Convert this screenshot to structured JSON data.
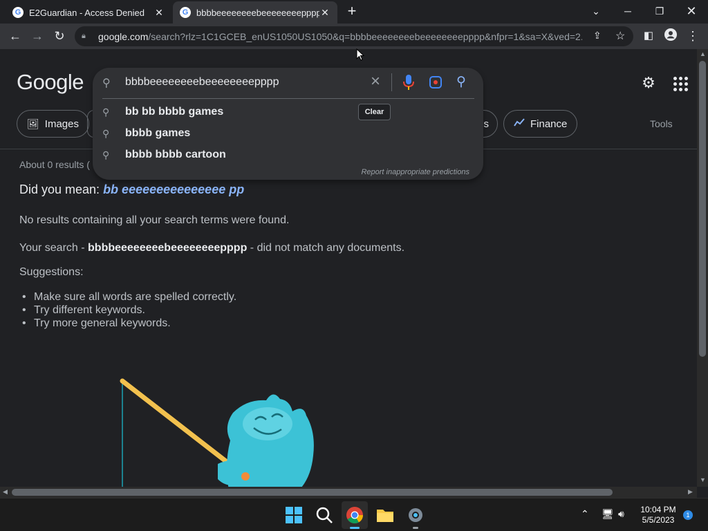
{
  "browser": {
    "tabs": [
      {
        "title": "E2Guardian - Access Denied",
        "active": false
      },
      {
        "title": "bbbbeeeeeeeebeeeeeeeepppp -",
        "active": true
      }
    ],
    "url_host": "google.com",
    "url_path": "/search?rlz=1C1GCEB_enUS1050US1050&q=bbbbeeeeeeeebeeeeeeeepppp&nfpr=1&sa=X&ved=2..."
  },
  "google": {
    "logo": "Google",
    "query": "bbbbeeeeeeeebeeeeeeeepppp",
    "chips": {
      "images": "Images",
      "partial": "s",
      "finance": "Finance"
    },
    "tools": "Tools",
    "tooltip": "Clear",
    "suggestions": [
      "bb bb bbbb games",
      "bbbb games",
      "bbbb bbbb cartoon"
    ],
    "report": "Report inappropriate predictions"
  },
  "results": {
    "count": "About 0 results (",
    "did_you_mean_label": "Did you mean: ",
    "did_you_mean_value": "bb eeeeeeeeeeeeeee pp",
    "no_results": "No results containing all your search terms were found.",
    "search_prefix": "Your search - ",
    "search_term": "bbbbeeeeeeeebeeeeeeeepppp",
    "search_suffix": " - did not match any documents.",
    "suggestions_label": "Suggestions:",
    "tips": [
      "Make sure all words are spelled correctly.",
      "Try different keywords.",
      "Try more general keywords."
    ]
  },
  "taskbar": {
    "time": "10:04 PM",
    "date": "5/5/2023",
    "notifications": "1"
  },
  "colors": {
    "page_bg": "#202124",
    "link": "#8ab4f8",
    "accent": "#4285f4"
  }
}
